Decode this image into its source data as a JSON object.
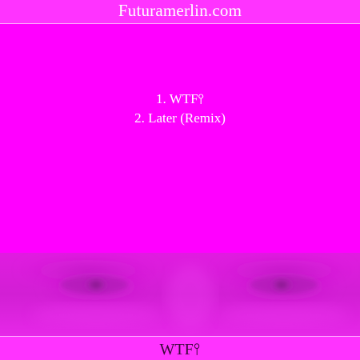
{
  "header": {
    "site": "Futuramerlin.com"
  },
  "tracklist": [
    {
      "label": "1. WTF⫯"
    },
    {
      "label": "2. Later (Remix)"
    }
  ],
  "footer": {
    "album_title": "WTF⫯"
  },
  "colors": {
    "background": "#ff00ff",
    "bar": "#ff33ff",
    "text_light": "#ffffff",
    "text_dark": "#3a0a3a"
  }
}
